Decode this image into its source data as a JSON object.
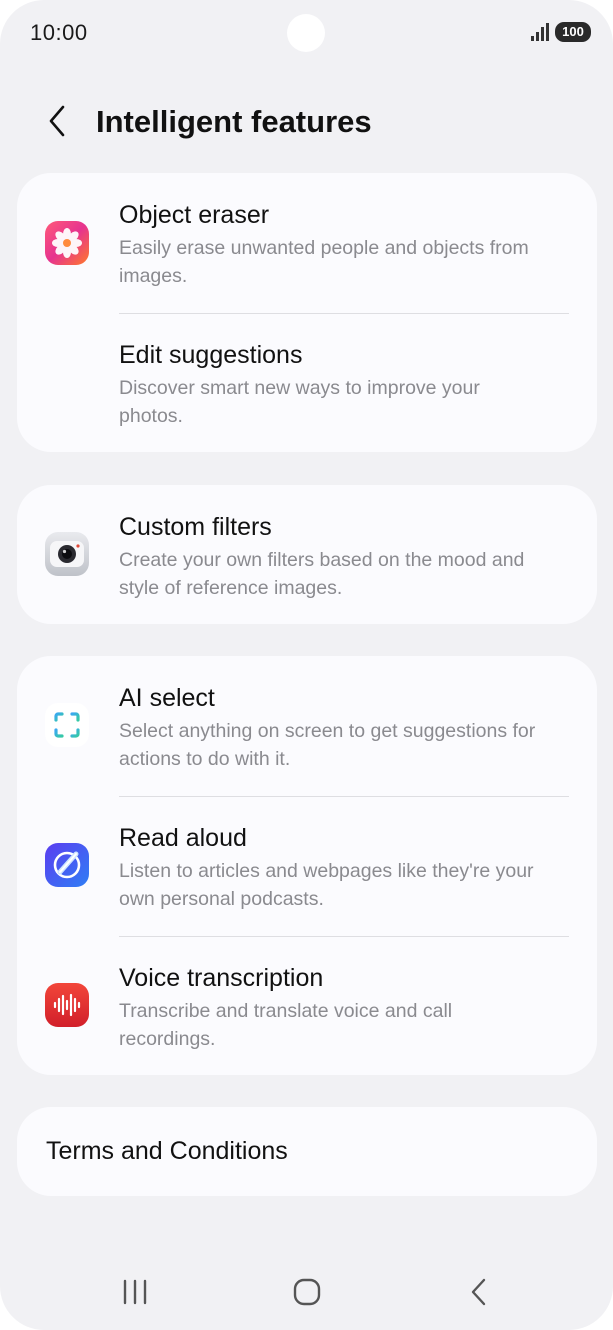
{
  "status_bar": {
    "time": "10:00",
    "battery": "100",
    "icons": [
      "signal-icon",
      "battery-icon"
    ]
  },
  "header": {
    "back_icon": "chevron-left-icon",
    "title": "Intelligent features"
  },
  "cards": [
    {
      "items": [
        {
          "icon": "object-eraser-flower-icon",
          "title": "Object eraser",
          "description": "Easily erase unwanted people and objects from images."
        },
        {
          "icon": "",
          "title": "Edit suggestions",
          "description": "Discover smart new ways to improve your photos."
        }
      ]
    },
    {
      "items": [
        {
          "icon": "camera-icon",
          "title": "Custom filters",
          "description": "Create your own filters based on the mood and style of reference images."
        }
      ]
    },
    {
      "items": [
        {
          "icon": "ai-select-icon",
          "title": "AI select",
          "description": "Select anything on screen to get suggestions for actions to do with it."
        },
        {
          "icon": "read-aloud-icon",
          "title": "Read aloud",
          "description": "Listen to articles and webpages like they're your own personal podcasts."
        },
        {
          "icon": "voice-recorder-icon",
          "title": "Voice transcription",
          "description": "Transcribe and translate voice and call recordings."
        }
      ]
    }
  ],
  "terms": {
    "label": "Terms and Conditions"
  },
  "nav_bar": {
    "icons": [
      "recents-icon",
      "home-icon",
      "back-icon"
    ]
  },
  "colors": {
    "background": "#f1f1f4",
    "card": "#fbfbfe",
    "text_primary": "#111111",
    "text_secondary": "#8a8a8f"
  }
}
